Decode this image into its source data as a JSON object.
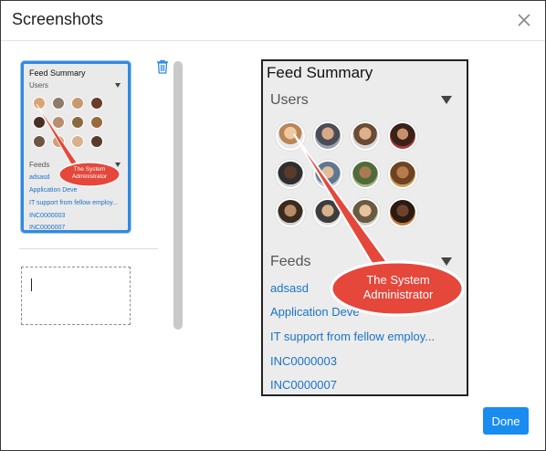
{
  "dialog": {
    "title": "Screenshots",
    "done_label": "Done"
  },
  "icons": {
    "close": "close-icon",
    "trash": "trash-icon",
    "collapse": "triangle-down-icon"
  },
  "colors": {
    "accent": "#1a8cf0",
    "link": "#1a73c9",
    "annotation": "#e5473b",
    "selected_border": "#2f8ae0"
  },
  "feed_summary": {
    "title": "Feed Summary",
    "users_label": "Users",
    "feeds_label": "Feeds",
    "feeds": [
      "adsasd",
      "Application Deve",
      "IT support from fellow employ...",
      "INC0000003",
      "INC0000007"
    ],
    "thumb_feeds": [
      "adsasd",
      "Application Deve",
      "IT support from fellow employ...",
      "INC0000003",
      "INC0000007"
    ]
  },
  "annotation": {
    "line1": "The System",
    "line2": "Administrator"
  }
}
